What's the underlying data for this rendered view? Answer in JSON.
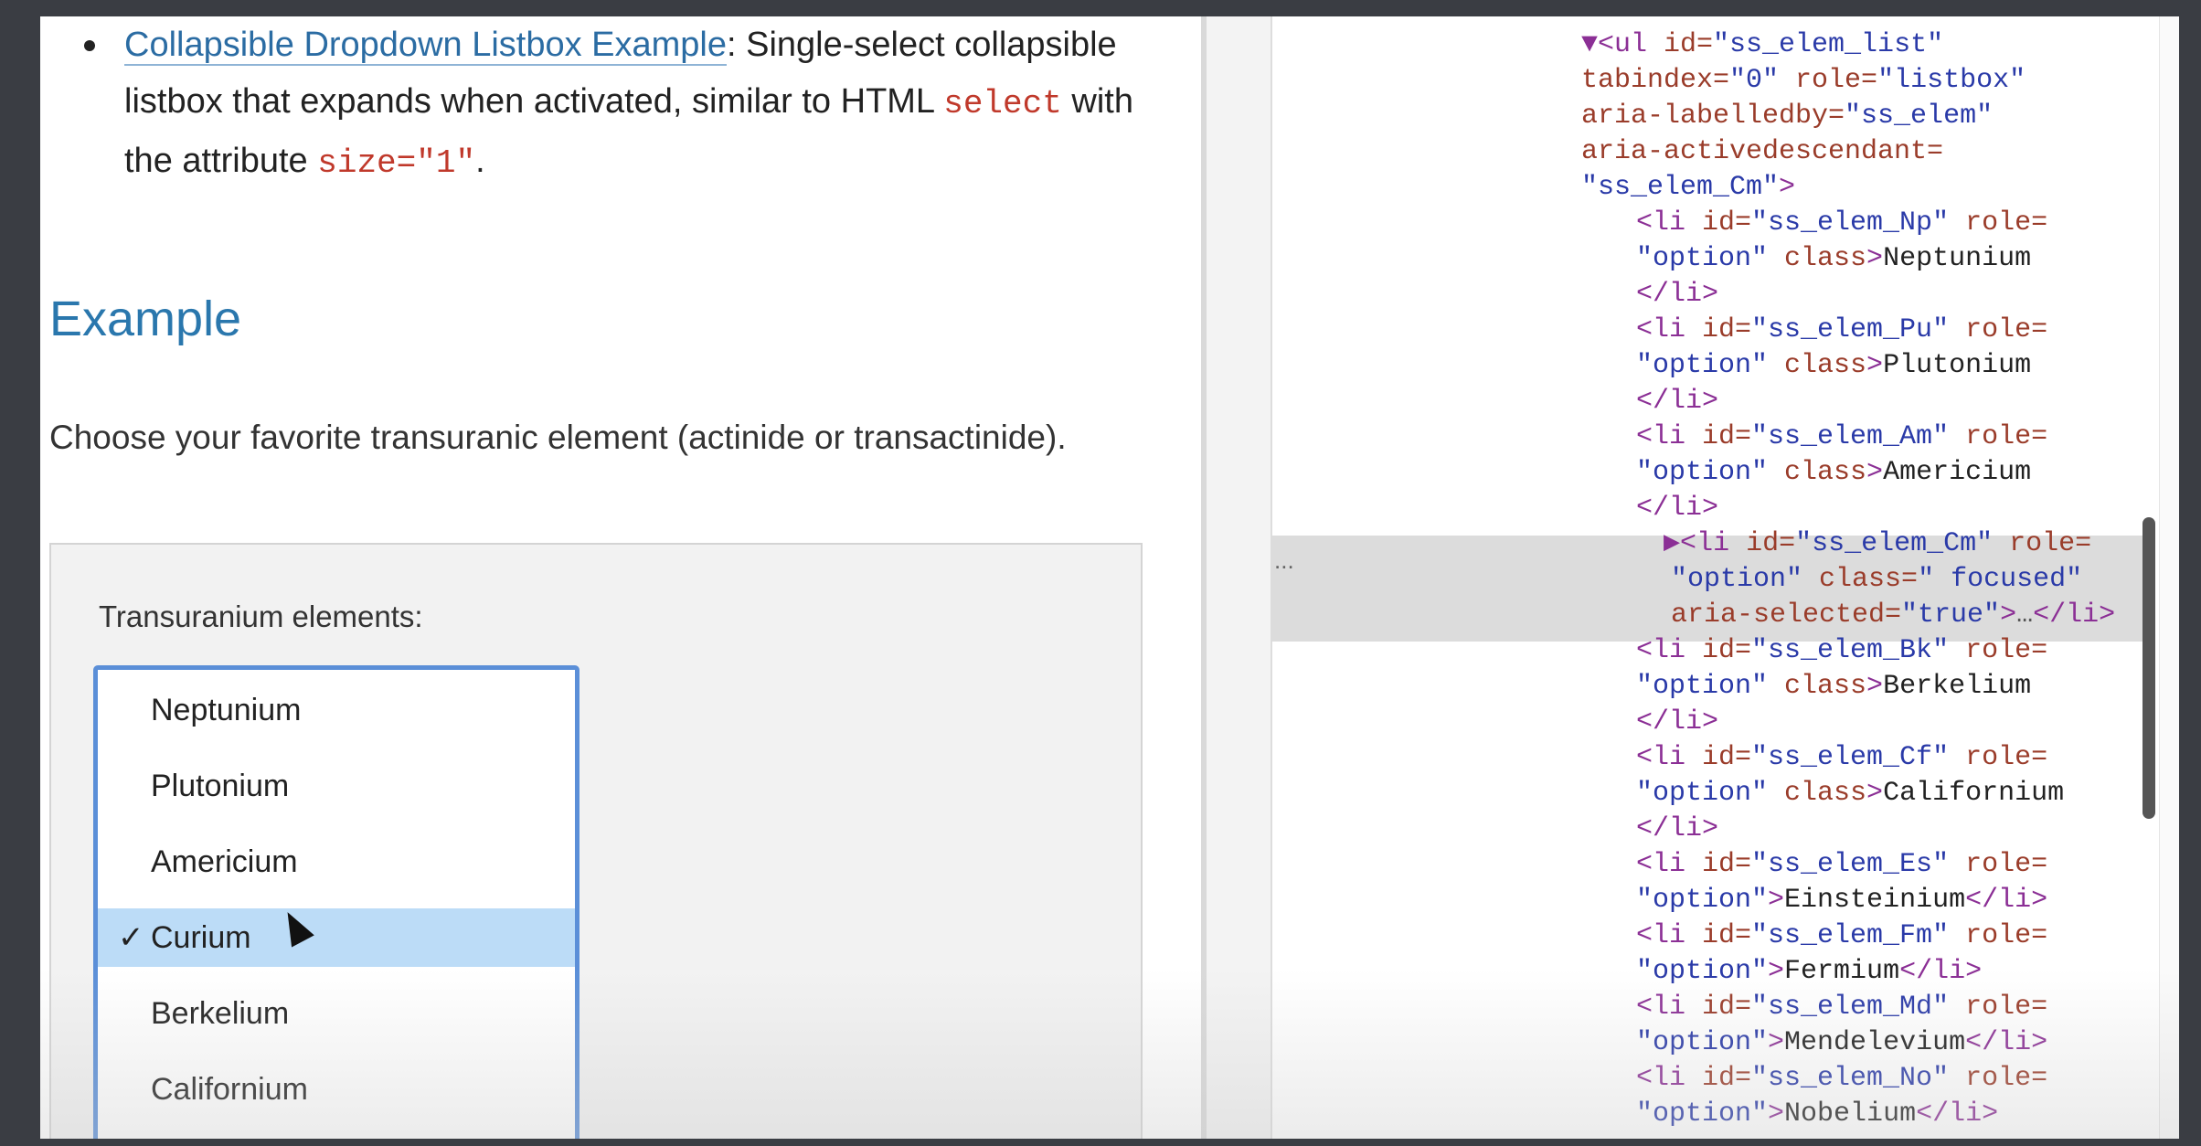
{
  "page": {
    "bullet": {
      "link_text": "Collapsible Dropdown Listbox Example",
      "text_after_link": ": Single-select collapsible listbox that expands when activated, similar to HTML ",
      "code_select": "select",
      "text_mid": " with the attribute ",
      "code_size": "size=\"1\"",
      "text_end": "."
    },
    "example_heading": "Example",
    "description": "Choose your favorite transuranic element (actinide or transactinide).",
    "listbox": {
      "label": "Transuranium elements:",
      "options": [
        "Neptunium",
        "Plutonium",
        "Americium",
        "Curium",
        "Berkelium",
        "Californium"
      ],
      "selected": "Curium",
      "check_mark": "✓"
    }
  },
  "devtools": {
    "gutter_marker": "...",
    "lines": [
      {
        "parts": [
          [
            "tag",
            "▼<ul "
          ],
          [
            "attr",
            "id="
          ],
          [
            "val",
            "\"ss_elem_list\""
          ]
        ]
      },
      {
        "parts": [
          [
            "attr",
            "tabindex="
          ],
          [
            "val",
            "\"0\" "
          ],
          [
            "attr",
            "role="
          ],
          [
            "val",
            "\"listbox\""
          ]
        ]
      },
      {
        "parts": [
          [
            "attr",
            "aria-labelledby="
          ],
          [
            "val",
            "\"ss_elem\""
          ]
        ]
      },
      {
        "parts": [
          [
            "attr",
            "aria-activedescendant="
          ]
        ]
      },
      {
        "parts": [
          [
            "val",
            "\"ss_elem_Cm\""
          ],
          [
            "tag",
            ">"
          ]
        ]
      },
      {
        "parts": [
          [
            "tag",
            "<li "
          ],
          [
            "attr",
            "id="
          ],
          [
            "val",
            "\"ss_elem_Np\" "
          ],
          [
            "attr",
            "role="
          ]
        ]
      },
      {
        "parts": [
          [
            "val",
            "\"option\" "
          ],
          [
            "attr",
            "class"
          ],
          [
            "tag",
            ">"
          ],
          [
            "txtc",
            "Neptunium"
          ]
        ]
      },
      {
        "parts": [
          [
            "tag",
            "</li>"
          ]
        ]
      },
      {
        "parts": [
          [
            "tag",
            "<li "
          ],
          [
            "attr",
            "id="
          ],
          [
            "val",
            "\"ss_elem_Pu\" "
          ],
          [
            "attr",
            "role="
          ]
        ]
      },
      {
        "parts": [
          [
            "val",
            "\"option\" "
          ],
          [
            "attr",
            "class"
          ],
          [
            "tag",
            ">"
          ],
          [
            "txtc",
            "Plutonium"
          ]
        ]
      },
      {
        "parts": [
          [
            "tag",
            "</li>"
          ]
        ]
      },
      {
        "parts": [
          [
            "tag",
            "<li "
          ],
          [
            "attr",
            "id="
          ],
          [
            "val",
            "\"ss_elem_Am\" "
          ],
          [
            "attr",
            "role="
          ]
        ]
      },
      {
        "parts": [
          [
            "val",
            "\"option\" "
          ],
          [
            "attr",
            "class"
          ],
          [
            "tag",
            ">"
          ],
          [
            "txtc",
            "Americium"
          ]
        ]
      },
      {
        "parts": [
          [
            "tag",
            "</li>"
          ]
        ]
      },
      {
        "parts": [
          [
            "tag",
            "▶<li "
          ],
          [
            "attr",
            "id="
          ],
          [
            "val",
            "\"ss_elem_Cm\" "
          ],
          [
            "attr",
            "role="
          ]
        ]
      },
      {
        "parts": [
          [
            "val",
            "\"option\" "
          ],
          [
            "attr",
            "class="
          ],
          [
            "val",
            "\" focused\""
          ]
        ]
      },
      {
        "parts": [
          [
            "attr",
            "aria-selected="
          ],
          [
            "val",
            "\"true\""
          ],
          [
            "tag",
            ">"
          ],
          [
            "ellip",
            "…"
          ],
          [
            "tag",
            "</li>"
          ]
        ]
      },
      {
        "parts": [
          [
            "tag",
            "<li "
          ],
          [
            "attr",
            "id="
          ],
          [
            "val",
            "\"ss_elem_Bk\" "
          ],
          [
            "attr",
            "role="
          ]
        ]
      },
      {
        "parts": [
          [
            "val",
            "\"option\" "
          ],
          [
            "attr",
            "class"
          ],
          [
            "tag",
            ">"
          ],
          [
            "txtc",
            "Berkelium"
          ]
        ]
      },
      {
        "parts": [
          [
            "tag",
            "</li>"
          ]
        ]
      },
      {
        "parts": [
          [
            "tag",
            "<li "
          ],
          [
            "attr",
            "id="
          ],
          [
            "val",
            "\"ss_elem_Cf\" "
          ],
          [
            "attr",
            "role="
          ]
        ]
      },
      {
        "parts": [
          [
            "val",
            "\"option\" "
          ],
          [
            "attr",
            "class"
          ],
          [
            "tag",
            ">"
          ],
          [
            "txtc",
            "Californium"
          ]
        ]
      },
      {
        "parts": [
          [
            "tag",
            "</li>"
          ]
        ]
      },
      {
        "parts": [
          [
            "tag",
            "<li "
          ],
          [
            "attr",
            "id="
          ],
          [
            "val",
            "\"ss_elem_Es\" "
          ],
          [
            "attr",
            "role="
          ]
        ]
      },
      {
        "parts": [
          [
            "val",
            "\"option\""
          ],
          [
            "tag",
            ">"
          ],
          [
            "txtc",
            "Einsteinium"
          ],
          [
            "tag",
            "</li>"
          ]
        ]
      },
      {
        "parts": [
          [
            "tag",
            "<li "
          ],
          [
            "attr",
            "id="
          ],
          [
            "val",
            "\"ss_elem_Fm\" "
          ],
          [
            "attr",
            "role="
          ]
        ]
      },
      {
        "parts": [
          [
            "val",
            "\"option\""
          ],
          [
            "tag",
            ">"
          ],
          [
            "txtc",
            "Fermium"
          ],
          [
            "tag",
            "</li>"
          ]
        ]
      },
      {
        "parts": [
          [
            "tag",
            "<li "
          ],
          [
            "attr",
            "id="
          ],
          [
            "val",
            "\"ss_elem_Md\" "
          ],
          [
            "attr",
            "role="
          ]
        ]
      },
      {
        "parts": [
          [
            "val",
            "\"option\""
          ],
          [
            "tag",
            ">"
          ],
          [
            "txtc",
            "Mendelevium"
          ],
          [
            "tag",
            "</li>"
          ]
        ]
      },
      {
        "parts": [
          [
            "tag",
            "<li "
          ],
          [
            "attr",
            "id="
          ],
          [
            "val",
            "\"ss_elem_No\" "
          ],
          [
            "attr",
            "role="
          ]
        ]
      },
      {
        "parts": [
          [
            "val",
            "\"option\""
          ],
          [
            "tag",
            ">"
          ],
          [
            "txtc",
            "Nobelium"
          ],
          [
            "tag",
            "</li>"
          ]
        ]
      }
    ]
  }
}
